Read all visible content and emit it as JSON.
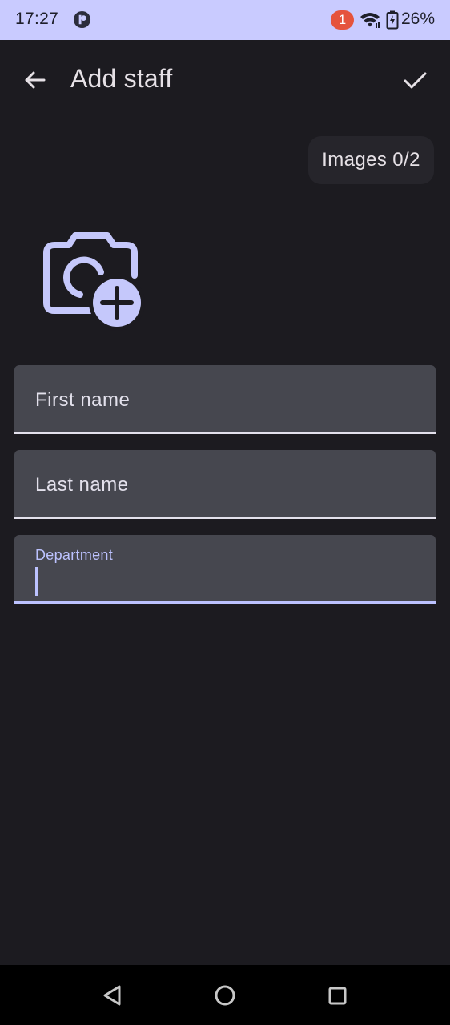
{
  "status_bar": {
    "time": "17:27",
    "notification_count": "1",
    "battery_percent": "26%",
    "background_color": "#c9cbff",
    "badge_color": "#e5533c"
  },
  "app_bar": {
    "title": "Add staff",
    "back_icon": "arrow-back-icon",
    "save_icon": "check-icon"
  },
  "images_chip": {
    "label": "Images 0/2"
  },
  "add_photo": {
    "icon": "add-a-photo-icon",
    "color": "#c5c8fb"
  },
  "form": {
    "first_name": {
      "label": "First name",
      "value": ""
    },
    "last_name": {
      "label": "Last name",
      "value": ""
    },
    "department": {
      "label": "Department",
      "value": "",
      "focused": true
    }
  },
  "nav_bar": {
    "back_icon": "triangle-back-icon",
    "home_icon": "circle-home-icon",
    "recents_icon": "square-recents-icon"
  },
  "colors": {
    "background": "#1c1b20",
    "field_fill": "#46474f",
    "accent": "#bcc2ff",
    "on_surface": "#e6e1e6"
  }
}
